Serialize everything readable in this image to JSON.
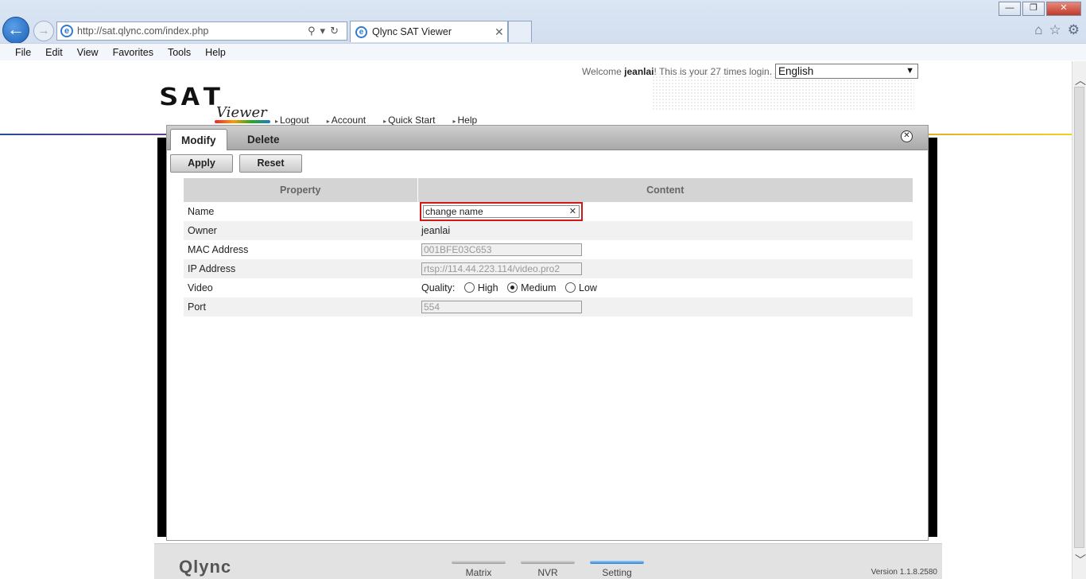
{
  "browser": {
    "url": "http://sat.qlync.com/index.php",
    "tab_title": "Qlync SAT Viewer",
    "menu": [
      "File",
      "Edit",
      "View",
      "Favorites",
      "Tools",
      "Help"
    ]
  },
  "header": {
    "welcome_prefix": "Welcome ",
    "username": "jeanlai",
    "welcome_suffix": "! This is your 27 times login.",
    "language": "English",
    "logo_main": "SAT",
    "logo_sub": "Viewer",
    "nav": [
      "Logout",
      "Account",
      "Quick Start",
      "Help"
    ]
  },
  "dialog": {
    "tabs": [
      "Modify",
      "Delete"
    ],
    "apply_label": "Apply",
    "reset_label": "Reset",
    "columns": [
      "Property",
      "Content"
    ],
    "rows": {
      "name_label": "Name",
      "name_value": "change name",
      "owner_label": "Owner",
      "owner_value": "jeanlai",
      "mac_label": "MAC Address",
      "mac_value": "001BFE03C653",
      "ip_label": "IP Address",
      "ip_value": "rtsp://114.44.223.114/video.pro2",
      "video_label": "Video",
      "quality_label": "Quality:",
      "quality_options": [
        "High",
        "Medium",
        "Low"
      ],
      "quality_selected": "Medium",
      "port_label": "Port",
      "port_value": "554"
    }
  },
  "footer": {
    "logo": "Qlync",
    "tabs": [
      "Matrix",
      "NVR",
      "Setting"
    ],
    "active_tab": "Setting",
    "version": "Version 1.1.8.2580"
  },
  "colors": {
    "highlight_border": "#d01818",
    "active_footer_tab": "#2a7fd2"
  }
}
